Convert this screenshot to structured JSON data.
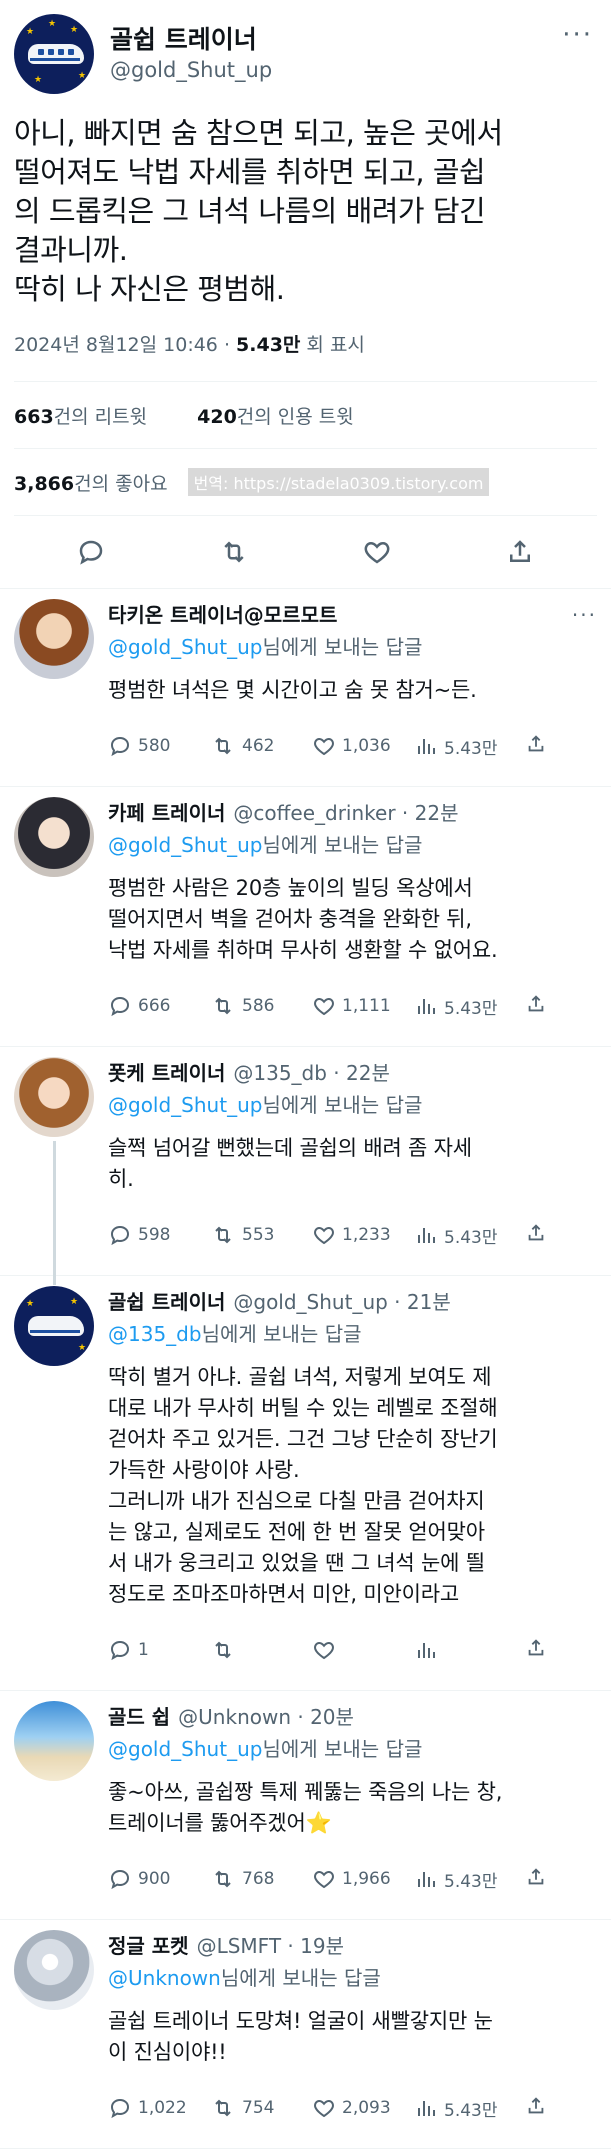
{
  "main_tweet": {
    "display_name": "골쉽 트레이너",
    "handle": "@gold_Shut_up",
    "more": "···",
    "text": "아니, 빠지면 숨 참으면 되고, 높은 곳에서\n떨어져도 낙법 자세를 취하면 되고, 골쉽\n의 드롭킥은 그 녀석 나름의 배려가 담긴\n결과니까.\n딱히 나 자신은 평범해.",
    "timestamp": "2024년 8월12일 10:46",
    "dot": " · ",
    "views": "5.43만",
    "views_label": " 회 표시"
  },
  "stats": {
    "retweets_count": "663",
    "retweets_label": "건의 리트윗",
    "quotes_count": "420",
    "quotes_label": "건의 인용 트윗",
    "likes_count": "3,866",
    "likes_label": "건의 좋아요",
    "watermark": "번역: https://stadela0309.tistory.com"
  },
  "replies": [
    {
      "name": "타키온 트레이너@모르모트",
      "handle": "",
      "time": "",
      "more": "···",
      "to_mention": "@gold_Shut_up",
      "to_suffix": "님에게 보내는 답글",
      "text": "평범한 녀석은 몇 시간이고 숨 못 참거~든.",
      "replies": "580",
      "retweets": "462",
      "likes": "1,036",
      "views": "5.43만"
    },
    {
      "name": "카페 트레이너",
      "handle": "@coffee_drinker · 22분",
      "time": "",
      "more": "",
      "to_mention": "@gold_Shut_up",
      "to_suffix": "님에게 보내는 답글",
      "text": "평범한 사람은 20층 높이의 빌딩 옥상에서\n떨어지면서 벽을 걷어차 충격을 완화한 뒤,\n낙법 자세를 취하며 무사히 생환할 수 없어요.",
      "replies": "666",
      "retweets": "586",
      "likes": "1,111",
      "views": "5.43만"
    },
    {
      "name": "폿케 트레이너",
      "handle": "@135_db · 22분",
      "time": "",
      "more": "",
      "to_mention": "@gold_Shut_up",
      "to_suffix": "님에게 보내는 답글",
      "text": "슬쩍 넘어갈 뻔했는데 골쉽의 배려 좀 자세\n히.",
      "replies": "598",
      "retweets": "553",
      "likes": "1,233",
      "views": "5.43만"
    },
    {
      "name": "골쉽 트레이너",
      "handle": "@gold_Shut_up · 21분",
      "time": "",
      "more": "",
      "to_mention": "@135_db",
      "to_suffix": "님에게 보내는 답글",
      "text": "딱히 별거 아냐. 골쉽 녀석, 저렇게 보여도 제\n대로 내가 무사히 버틸 수 있는 레벨로 조절해\n걷어차 주고 있거든. 그건 그냥 단순히 장난기\n가득한 사랑이야 사랑.\n그러니까 내가 진심으로 다칠 만큼 걷어차지\n는 않고, 실제로도 전에 한 번 잘못 얻어맞아\n서 내가 웅크리고 있었을 땐 그 녀석 눈에 띌\n정도로 조마조마하면서 미안, 미안이라고",
      "replies": "1",
      "retweets": "",
      "likes": "",
      "views": ""
    },
    {
      "name": "골드 쉽",
      "handle": "@Unknown · 20분",
      "time": "",
      "more": "",
      "to_mention": "@gold_Shut_up",
      "to_suffix": "님에게 보내는 답글",
      "text": "좋~아쓰, 골쉽짱 특제 꿰뚫는 죽음의 나는 창,\n트레이너를 뚫어주겠어⭐",
      "replies": "900",
      "retweets": "768",
      "likes": "1,966",
      "views": "5.43만"
    },
    {
      "name": "정글 포켓",
      "handle": "@LSMFT · 19분",
      "time": "",
      "more": "",
      "to_mention": "@Unknown",
      "to_suffix": "님에게 보내는 답글",
      "text": "골쉽 트레이너 도망쳐! 얼굴이 새빨갛지만 눈\n이 진심이야!!",
      "replies": "1,022",
      "retweets": "754",
      "likes": "2,093",
      "views": "5.43만"
    }
  ],
  "colors": {
    "link": "#1d9bf0",
    "muted": "#536471",
    "text": "#0f1419",
    "divider": "#eff3f4",
    "avatar_bg": "#0d1f5c"
  }
}
